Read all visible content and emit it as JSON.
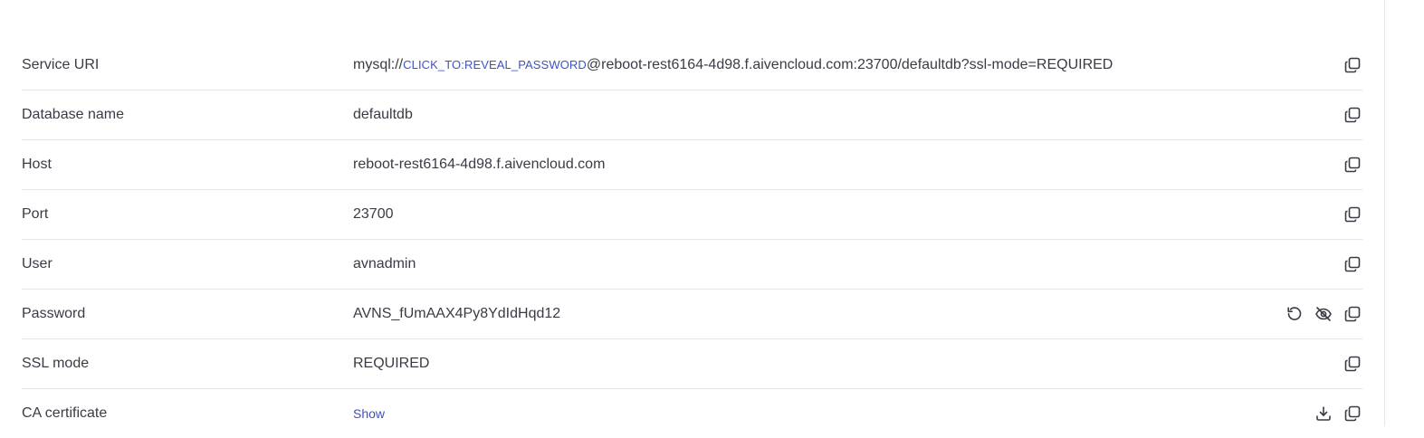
{
  "rows": [
    {
      "label": "Service URI",
      "value_prefix": "mysql://",
      "value_link": "CLICK_TO:REVEAL_PASSWORD",
      "value_suffix": "@reboot-rest6164-4d98.f.aivencloud.com:23700/defaultdb?ssl-mode=REQUIRED",
      "actions": [
        "copy-icon"
      ]
    },
    {
      "label": "Database name",
      "value": "defaultdb",
      "actions": [
        "copy-icon"
      ]
    },
    {
      "label": "Host",
      "value": "reboot-rest6164-4d98.f.aivencloud.com",
      "actions": [
        "copy-icon"
      ]
    },
    {
      "label": "Port",
      "value": "23700",
      "actions": [
        "copy-icon"
      ]
    },
    {
      "label": "User",
      "value": "avnadmin",
      "actions": [
        "copy-icon"
      ]
    },
    {
      "label": "Password",
      "value": "AVNS_fUmAAX4Py8YdIdHqd12",
      "actions": [
        "reset-icon",
        "eye-off-icon",
        "copy-icon"
      ]
    },
    {
      "label": "SSL mode",
      "value": "REQUIRED",
      "actions": [
        "copy-icon"
      ]
    },
    {
      "label": "CA certificate",
      "value_link": "Show",
      "actions": [
        "download-icon",
        "copy-icon"
      ]
    }
  ],
  "colors": {
    "text": "#3a3b45",
    "link": "#3f51c7",
    "divider": "#e4e5ea",
    "icon": "#3a3b45"
  }
}
